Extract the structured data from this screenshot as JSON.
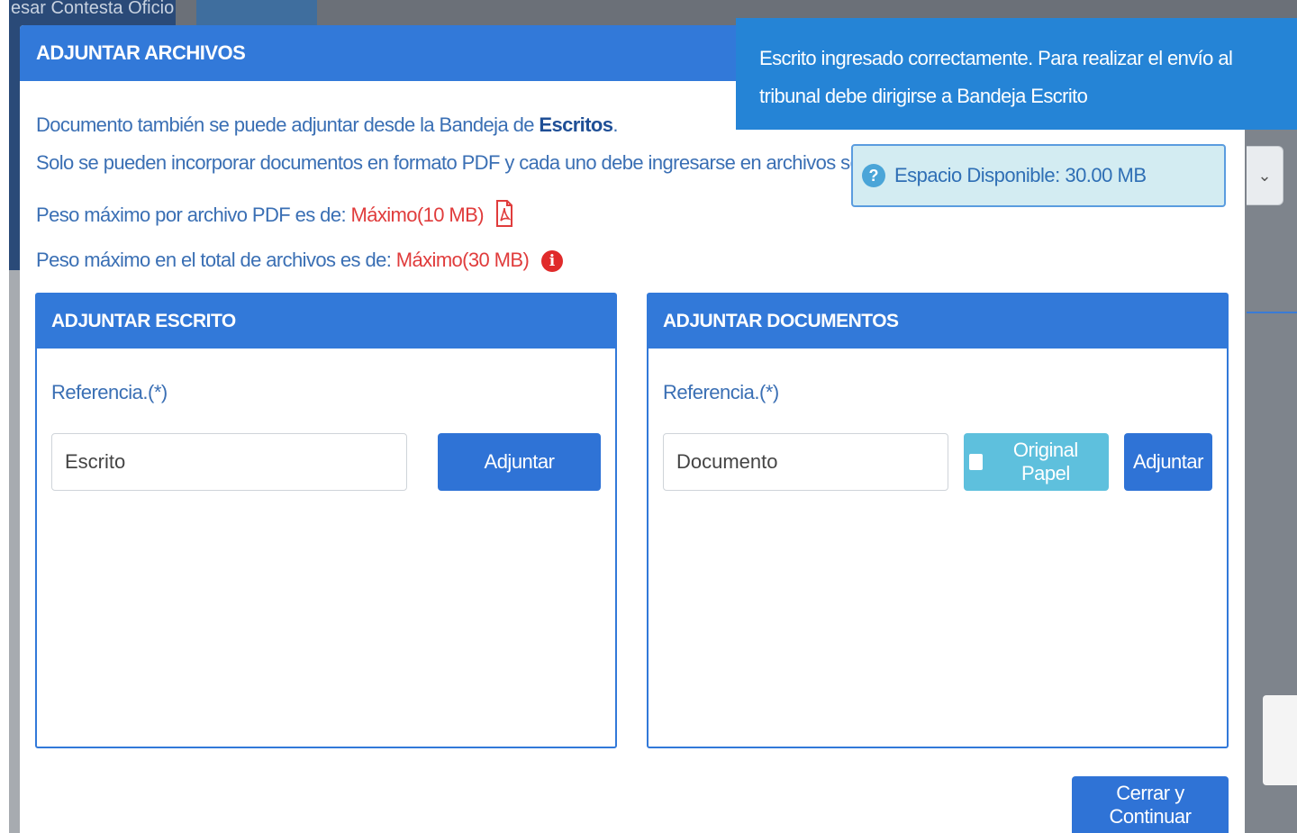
{
  "background": {
    "top_label": "esar Contesta Oficio",
    "select_chevron": "chevron-down-icon"
  },
  "modal": {
    "title": "ADJUNTAR ARCHIVOS",
    "info": {
      "line1_prefix": "Documento también se puede adjuntar desde la Bandeja de ",
      "line1_bold": "Escritos",
      "line1_suffix": ".",
      "line2": "Solo se pueden incorporar documentos en formato PDF y cada uno debe ingresarse en archivos separados.",
      "line3_prefix": "Peso máximo por archivo PDF es de: ",
      "line3_value": "Máximo(10 MB)",
      "line4_prefix": "Peso máximo en el total de archivos es de: ",
      "line4_value": "Máximo(30 MB)"
    },
    "space": {
      "icon": "question-circle-icon",
      "text": "Espacio Disponible: 30.00 MB"
    },
    "escrito_panel": {
      "title": "ADJUNTAR ESCRITO",
      "ref_label": "Referencia.(*)",
      "input_placeholder": "Escrito",
      "attach_label": "Adjuntar"
    },
    "documentos_panel": {
      "title": "ADJUNTAR DOCUMENTOS",
      "ref_label": "Referencia.(*)",
      "input_placeholder": "Documento",
      "original_label": "Original Papel",
      "attach_label": "Adjuntar"
    },
    "close_label": "Cerrar y Continuar"
  },
  "toast": {
    "message": "Escrito ingresado correctamente. Para realizar el envío al tribunal debe dirigirse a Bandeja Escrito"
  },
  "colors": {
    "primary": "#3279d9",
    "info_text": "#3a6fb4",
    "danger": "#e03c3c",
    "toast_bg": "#2584d6",
    "info_box_bg": "#d3ecf2",
    "cyan_button": "#5ec0dd"
  }
}
